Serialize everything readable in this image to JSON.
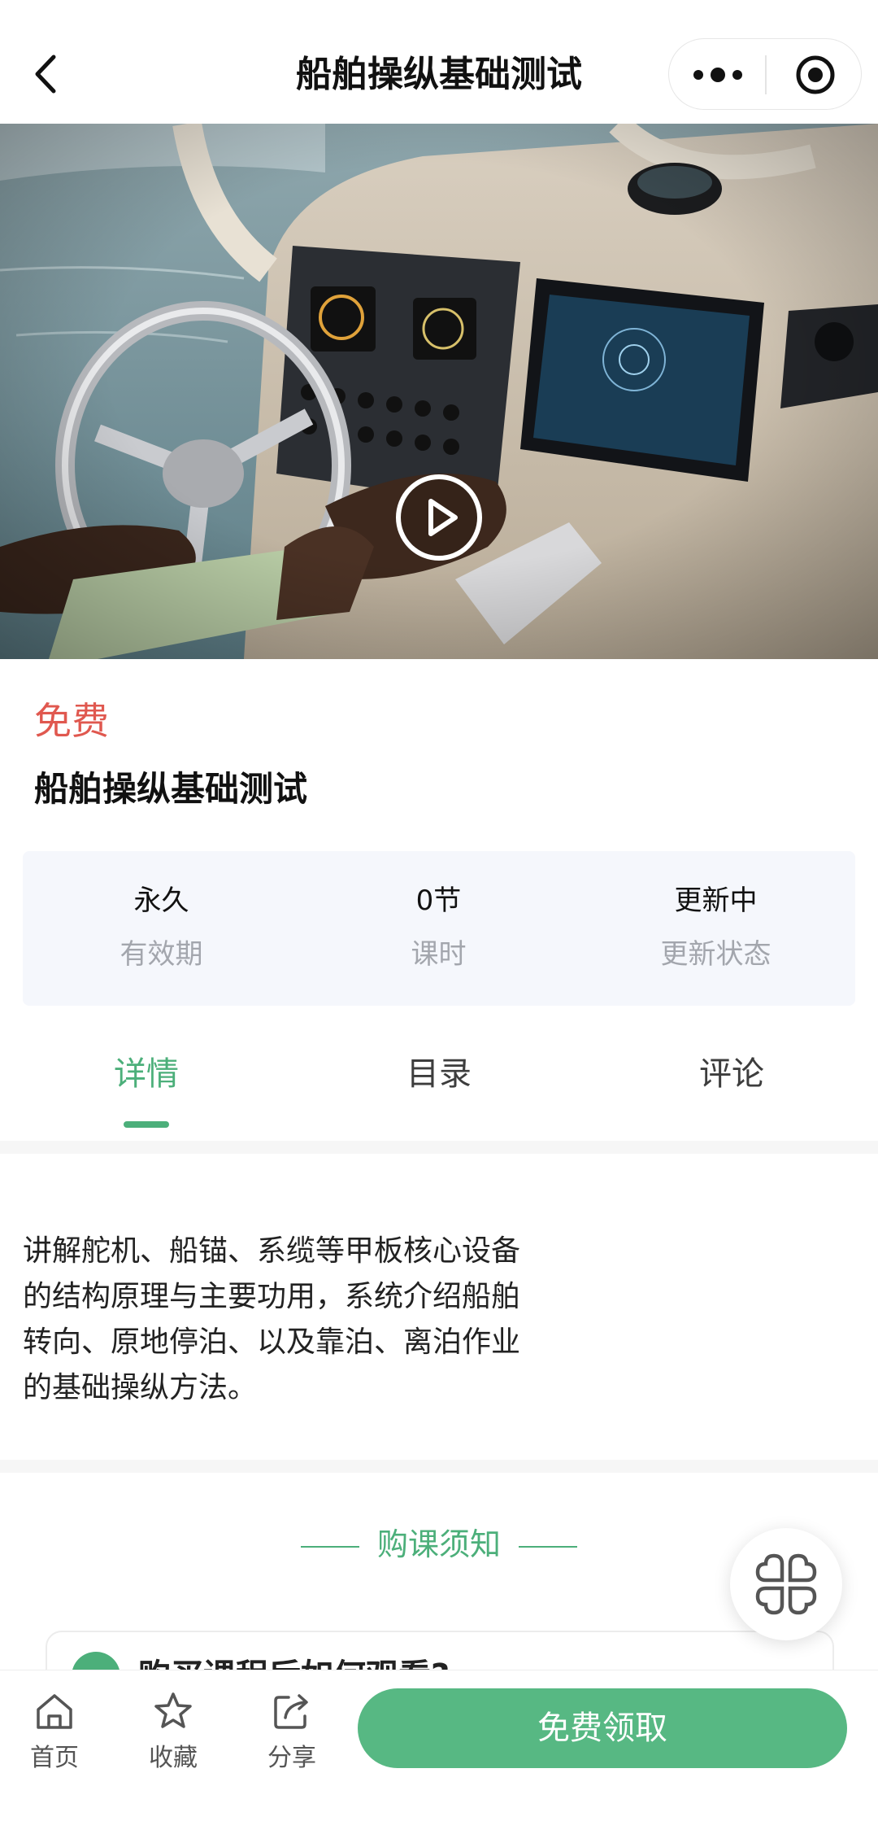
{
  "header": {
    "title": "船舶操纵基础测试"
  },
  "colors": {
    "accent": "#4caf7a",
    "price": "#e0584f",
    "cta": "#57b883"
  },
  "icons": {
    "back": "chevron-left-icon",
    "more": "more-dots-icon",
    "close": "target-icon",
    "play": "play-icon",
    "float": "grid-menu-icon"
  },
  "course": {
    "price_label": "免费",
    "title": "船舶操纵基础测试",
    "stats": [
      {
        "value": "永久",
        "label": "有效期"
      },
      {
        "value": "0节",
        "label": "课时"
      },
      {
        "value": "更新中",
        "label": "更新状态"
      }
    ]
  },
  "tabs": [
    {
      "label": "详情",
      "active": true
    },
    {
      "label": "目录",
      "active": false
    },
    {
      "label": "评论",
      "active": false
    }
  ],
  "detail": {
    "lines": [
      "讲解舵机、船锚、系缆等甲板核心设备",
      "的结构原理与主要功用，系统介绍船舶",
      "转向、原地停泊、以及靠泊、离泊作业",
      "的基础操纵方法。"
    ]
  },
  "notice": {
    "title": "购课须知",
    "faq_partial": "购买课程后如何观看?"
  },
  "bottom_nav": {
    "items": [
      {
        "label": "首页",
        "icon": "home-icon"
      },
      {
        "label": "收藏",
        "icon": "star-icon"
      },
      {
        "label": "分享",
        "icon": "share-icon"
      }
    ],
    "cta_label": "免费领取"
  }
}
